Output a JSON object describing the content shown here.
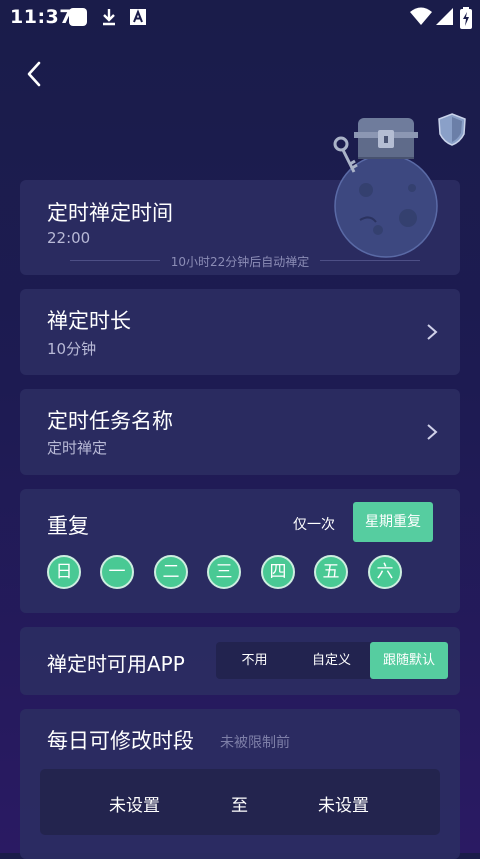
{
  "status_bar": {
    "time": "11:37"
  },
  "timer_card": {
    "title": "定时禅定时间",
    "time": "22:00",
    "hint": "10小时22分钟后自动禅定"
  },
  "duration_card": {
    "title": "禅定时长",
    "value": "10分钟"
  },
  "task_card": {
    "title": "定时任务名称",
    "value": "定时禅定"
  },
  "repeat_card": {
    "title": "重复",
    "option_once": "仅一次",
    "option_weekly": "星期重复",
    "days": [
      "日",
      "一",
      "二",
      "三",
      "四",
      "五",
      "六"
    ]
  },
  "app_card": {
    "title": "禅定时可用APP",
    "options": [
      "不用",
      "自定义",
      "跟随默认"
    ],
    "selected": "跟随默认"
  },
  "period_card": {
    "title": "每日可修改时段",
    "note": "未被限制前",
    "start": "未设置",
    "separator": "至",
    "end": "未设置"
  },
  "colors": {
    "accent": "#56cda0",
    "card": "#2b2c62",
    "background": "#1d1b52"
  },
  "icons": [
    "back-icon",
    "shield-icon",
    "chest-icon",
    "key-icon",
    "moon-planet",
    "chevron-right-icon"
  ]
}
